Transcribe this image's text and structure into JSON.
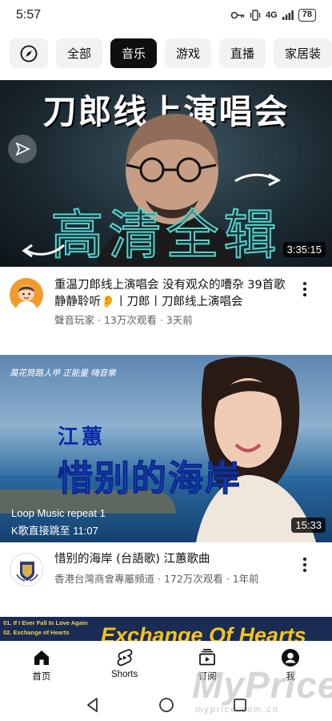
{
  "status_bar": {
    "time": "5:57",
    "network": "4G",
    "battery": "78"
  },
  "chips": [
    {
      "label": "全部"
    },
    {
      "label": "音乐"
    },
    {
      "label": "游戏"
    },
    {
      "label": "直播"
    },
    {
      "label": "家居装"
    }
  ],
  "videos": [
    {
      "thumbnail_headline": "刀郎线上演唱会",
      "thumbnail_overlay": "高清全辑",
      "duration": "3:35:15",
      "title": "重温刀郎线上演唱会 没有观众的嘈杂 39首歌静静聆听👂丨刀郎丨刀郎线上演唱会",
      "channel": "聲音玩家",
      "views": "13万次观看",
      "age": "3天前"
    },
    {
      "thumbnail_caption": "萬花筒路人甲 正能量 嗨音樂",
      "thumbnail_artist": "江蕙",
      "thumbnail_song": "惜别的海岸",
      "thumbnail_loop": "Loop Music repeat 1",
      "thumbnail_jump": "K歌直接跳至 11:07",
      "duration": "15:33",
      "title": "惜别的海岸 (台語歌) 江蕙歌曲",
      "channel": "香港台灣商會專屬頻道",
      "views": "172万次观看",
      "age": "1年前"
    },
    {
      "thumbnail_list_1": "01. If I Ever Fall In Love Again",
      "thumbnail_list_2": "02. Exchange of Hearts",
      "thumbnail_title": "Exchange Of Hearts"
    }
  ],
  "bottom_nav": [
    {
      "label": "首页",
      "icon": "home-icon"
    },
    {
      "label": "Shorts",
      "icon": "shorts-icon"
    },
    {
      "label": "订阅",
      "icon": "subscriptions-icon"
    },
    {
      "label": "我",
      "icon": "account-icon"
    }
  ],
  "watermark": "MyPrice",
  "watermark_url": "myprice.com.cn"
}
